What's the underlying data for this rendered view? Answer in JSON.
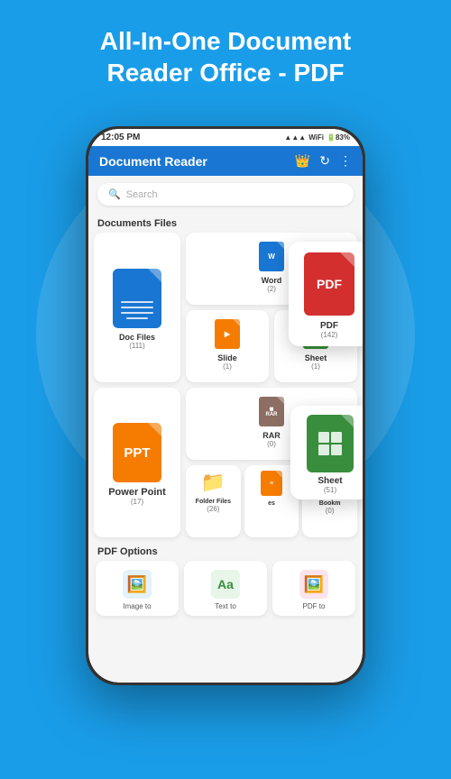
{
  "header": {
    "title": "All-In-One Document\nReader Office - PDF"
  },
  "phone": {
    "status_bar": {
      "time": "12:05 PM",
      "battery": "83"
    },
    "app_bar": {
      "title": "Document Reader"
    },
    "search": {
      "placeholder": "Search"
    },
    "sections": {
      "documents": {
        "title": "Documents Files",
        "items": [
          {
            "label": "Doc Files",
            "count": "(111)",
            "type": "doc",
            "size": "large"
          },
          {
            "label": "Word",
            "count": "(2)",
            "type": "word"
          },
          {
            "label": "PDF",
            "count": "(142)",
            "type": "pdf",
            "size": "large-float"
          },
          {
            "label": "Slide",
            "count": "(1)",
            "type": "slide"
          },
          {
            "label": "Sheet",
            "count": "(1)",
            "type": "sheet"
          },
          {
            "label": "Power Point",
            "count": "(17)",
            "type": "ppt",
            "size": "large"
          },
          {
            "label": "RAR",
            "count": "(0)",
            "type": "rar"
          },
          {
            "label": "Sheet",
            "count": "(51)",
            "type": "sheet-lg",
            "size": "large-float2"
          },
          {
            "label": "Folder Files",
            "count": "(26)",
            "type": "folder"
          },
          {
            "label": "es",
            "count": "",
            "type": "files"
          },
          {
            "label": "Bookm",
            "count": "(0)",
            "type": "bookmark"
          }
        ]
      },
      "pdf_options": {
        "title": "PDF Options",
        "items": [
          {
            "label": "Image to",
            "type": "image"
          },
          {
            "label": "Text to",
            "type": "text"
          },
          {
            "label": "PDF to",
            "type": "pdf-to"
          }
        ]
      }
    }
  },
  "icons": {
    "crown": "👑",
    "refresh": "↻",
    "more": "⋮",
    "search": "🔍",
    "image": "🖼",
    "text": "Aa",
    "pdf_convert": "🖼"
  }
}
